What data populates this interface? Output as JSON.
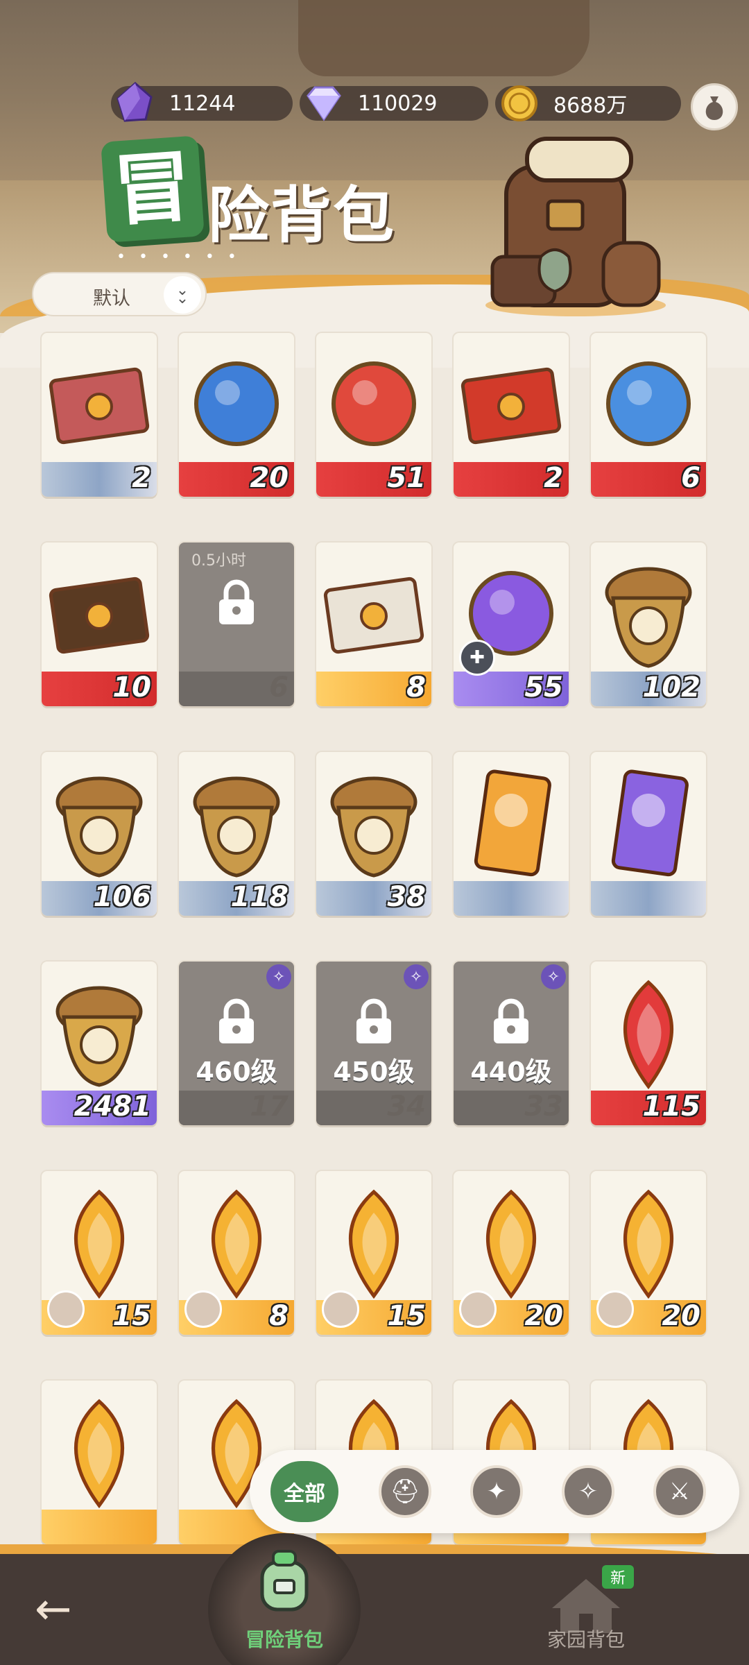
{
  "currencies": [
    {
      "name": "purple-crystal-icon",
      "value": "11244"
    },
    {
      "name": "diamond-icon",
      "value": "110029"
    },
    {
      "name": "gold-coin-icon",
      "value": "8688万"
    }
  ],
  "title": {
    "first_char": "冒",
    "rest": "险背包",
    "dots": "• • • • • •"
  },
  "sort": {
    "label": "默认"
  },
  "items": [
    {
      "icon": "ticket-icon",
      "count": "2",
      "band": "blue"
    },
    {
      "icon": "blue-orb-icon",
      "count": "20",
      "band": "red"
    },
    {
      "icon": "red-heart-crest-icon",
      "count": "51",
      "band": "red"
    },
    {
      "icon": "red-envelope-icon",
      "count": "2",
      "band": "red"
    },
    {
      "icon": "crystal-globe-icon",
      "count": "6",
      "band": "red"
    },
    {
      "icon": "dark-gift-envelope-icon",
      "count": "10",
      "band": "red"
    },
    {
      "icon": "hourglass-locked-icon",
      "count": "6",
      "band": "locked",
      "timer": "0.5小时"
    },
    {
      "icon": "white-envelope-icon",
      "count": "8",
      "band": "orange"
    },
    {
      "icon": "purple-flame-orb-icon",
      "count": "55",
      "band": "purple"
    },
    {
      "icon": "acorn-eye-icon",
      "count": "102",
      "band": "blue"
    },
    {
      "icon": "acorn-sun-icon",
      "count": "106",
      "band": "blue"
    },
    {
      "icon": "acorn-leaf-icon",
      "count": "118",
      "band": "blue"
    },
    {
      "icon": "acorn-star-icon",
      "count": "38",
      "band": "blue"
    },
    {
      "icon": "gold-ticket-icon",
      "count": "",
      "band": "blue"
    },
    {
      "icon": "purple-ticket-icon",
      "count": "",
      "band": "blue"
    },
    {
      "icon": "acorn-gold-icon",
      "count": "2481",
      "band": "purple"
    },
    {
      "icon": "locked-chest-icon",
      "count": "17",
      "band": "locked",
      "level": "460级"
    },
    {
      "icon": "locked-chest-icon",
      "count": "34",
      "band": "locked",
      "level": "450级"
    },
    {
      "icon": "locked-chest-icon",
      "count": "33",
      "band": "locked",
      "level": "440级"
    },
    {
      "icon": "red-gem-icon",
      "count": "115",
      "band": "red"
    },
    {
      "icon": "gold-gem-icon",
      "count": "15",
      "band": "orange"
    },
    {
      "icon": "gold-gem-icon",
      "count": "8",
      "band": "orange"
    },
    {
      "icon": "gold-gem-icon",
      "count": "15",
      "band": "orange"
    },
    {
      "icon": "gold-gem-icon",
      "count": "20",
      "band": "orange"
    },
    {
      "icon": "gold-gem-icon",
      "count": "20",
      "band": "orange"
    },
    {
      "icon": "gold-gem-icon",
      "count": "",
      "band": "orange"
    },
    {
      "icon": "gold-gem-icon",
      "count": "",
      "band": "orange"
    },
    {
      "icon": "gold-gem-icon",
      "count": "",
      "band": "orange"
    },
    {
      "icon": "gold-gem-icon",
      "count": "",
      "band": "orange"
    },
    {
      "icon": "gold-gem-icon",
      "count": "",
      "band": "orange"
    }
  ],
  "filters": {
    "all_label": "全部",
    "icons": [
      "warrior-helmet-icon",
      "star-shield-icon",
      "compass-icon",
      "sword-shield-icon"
    ]
  },
  "bottom": {
    "adventure_label": "冒险背包",
    "home_label": "家园背包",
    "new_badge": "新"
  },
  "colors": {
    "accent_green": "#4a8e55",
    "bottom_bar": "#453a36",
    "orange_edge": "#e9a640"
  }
}
